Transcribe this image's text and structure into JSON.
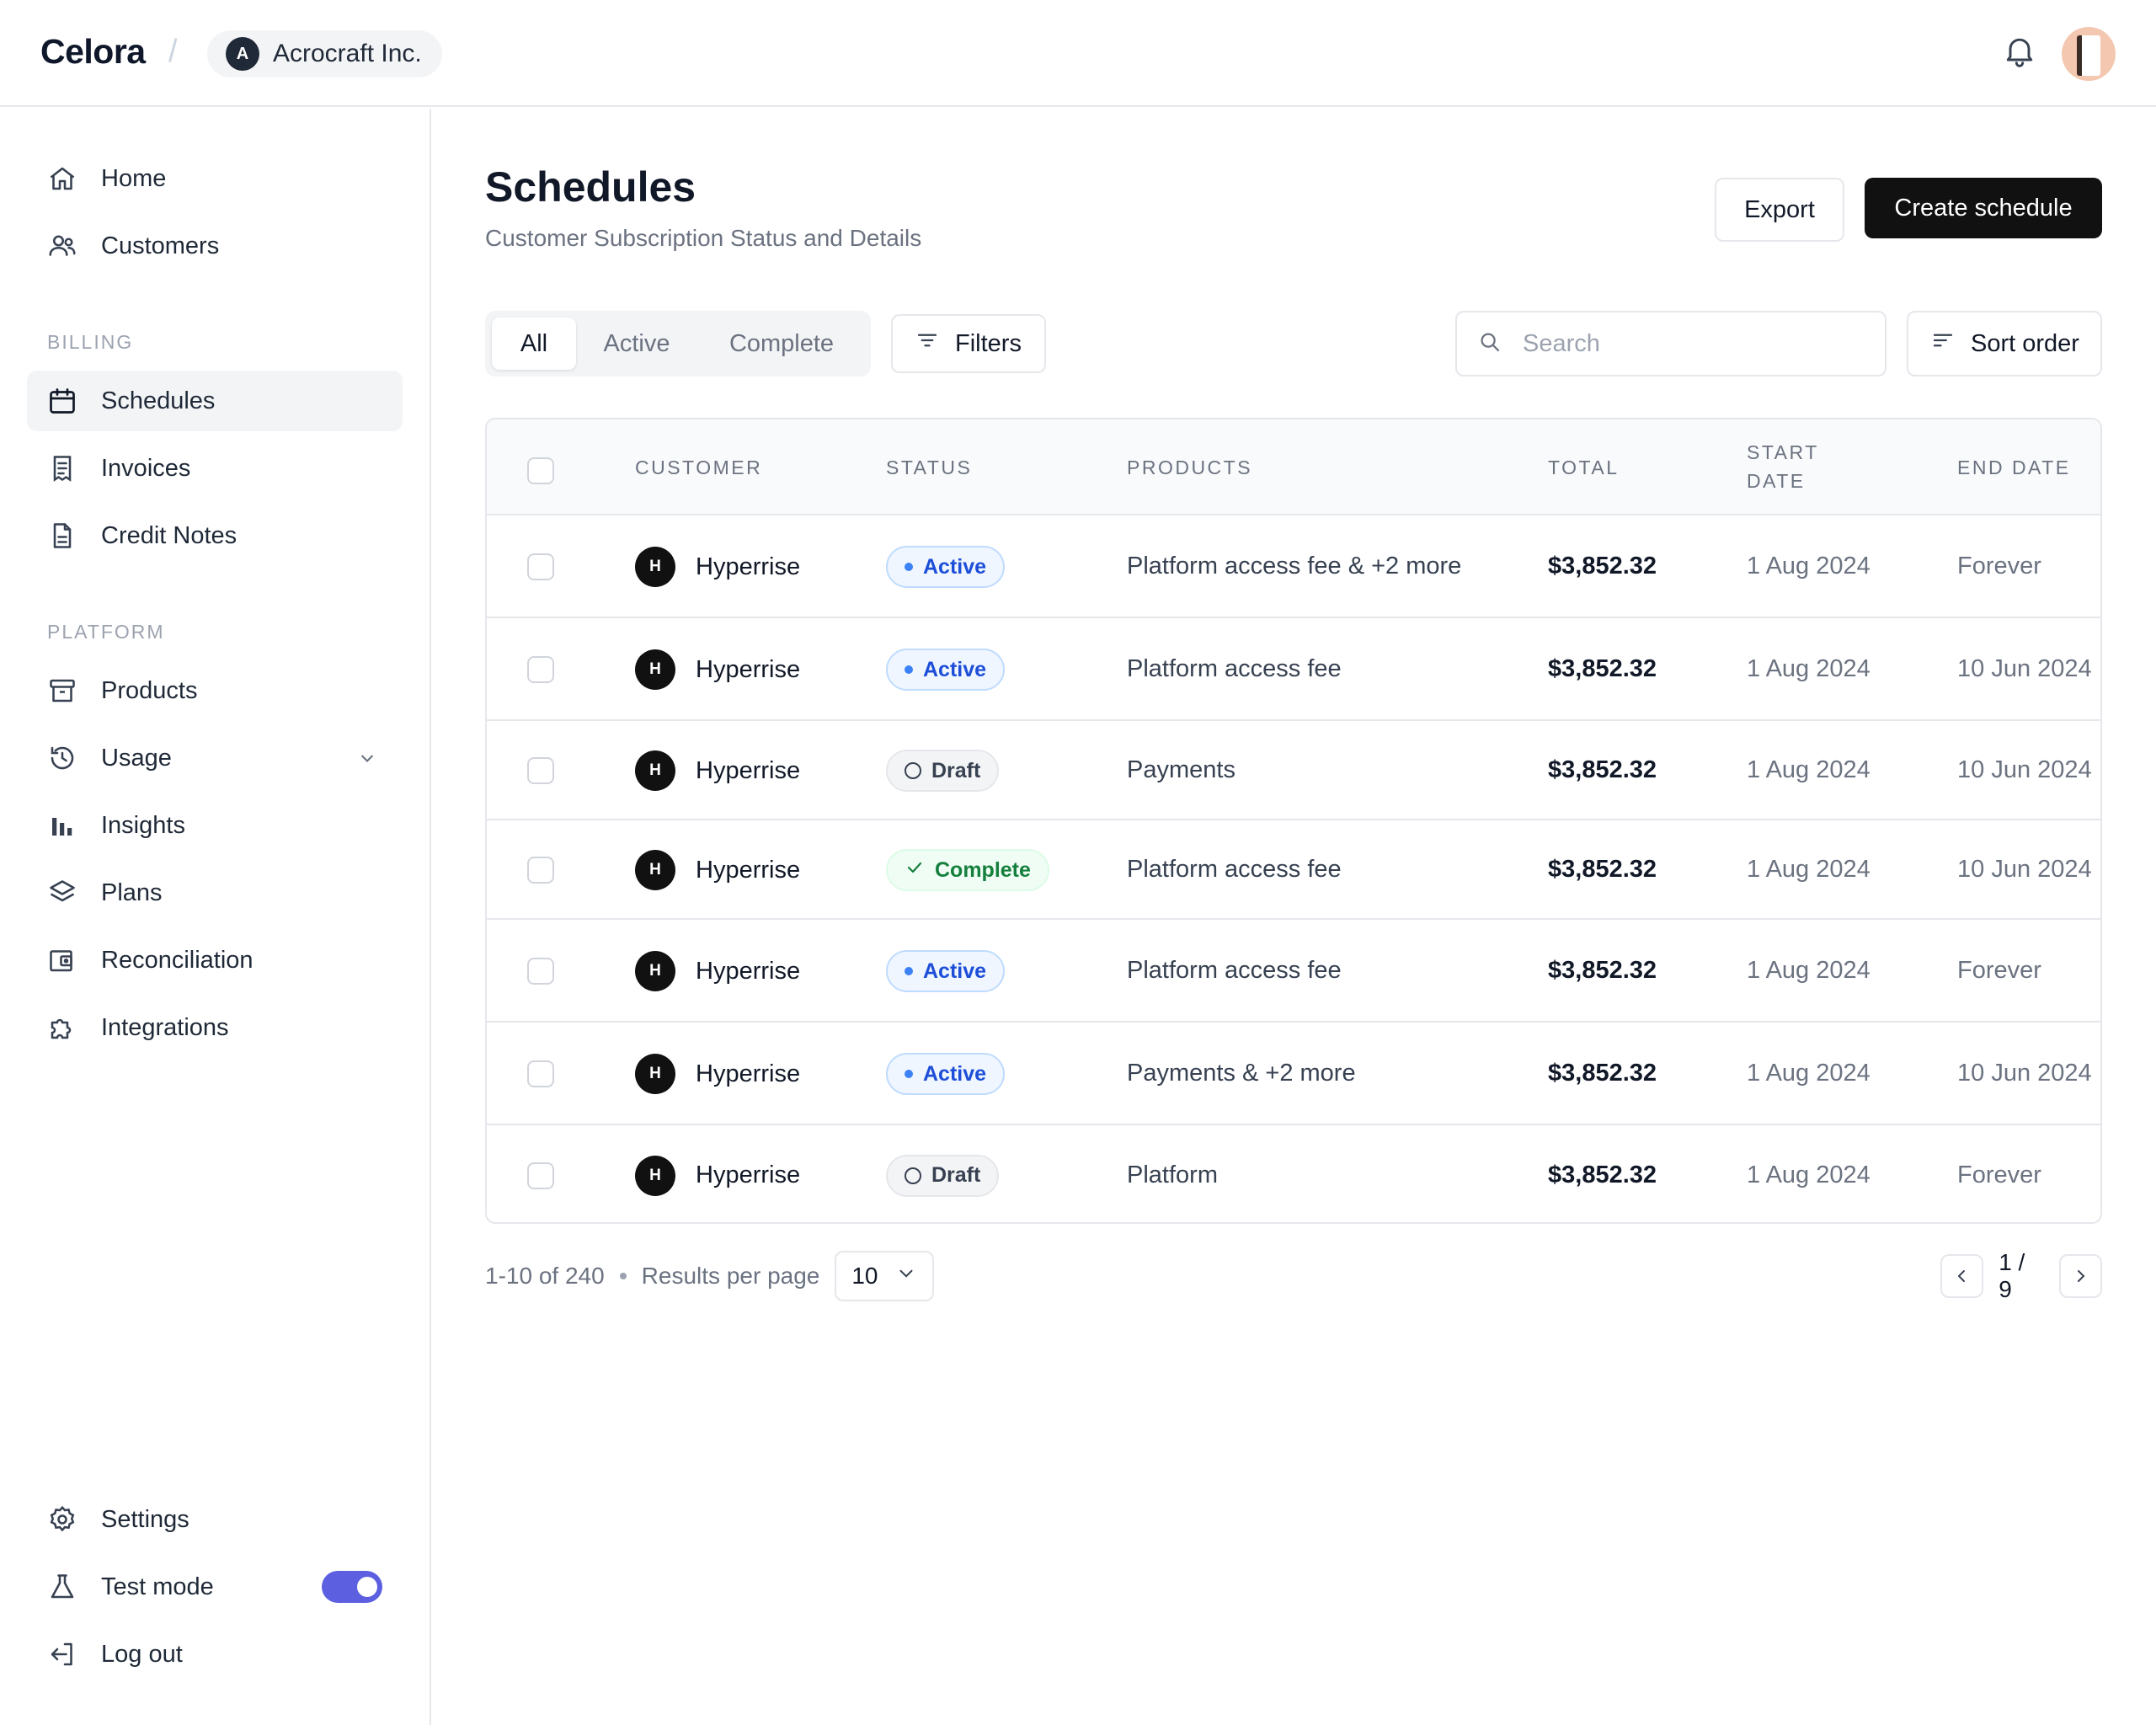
{
  "header": {
    "brand": "Celora",
    "separator": "/",
    "org": {
      "initial": "A",
      "name": "Acrocraft Inc."
    }
  },
  "sidebar": {
    "items_top": [
      {
        "label": "Home",
        "icon": "home-icon"
      },
      {
        "label": "Customers",
        "icon": "users-icon"
      }
    ],
    "section_billing": "BILLING",
    "items_billing": [
      {
        "label": "Schedules",
        "icon": "calendar-icon",
        "active": true
      },
      {
        "label": "Invoices",
        "icon": "receipt-icon"
      },
      {
        "label": "Credit Notes",
        "icon": "document-icon"
      }
    ],
    "section_platform": "PLATFORM",
    "items_platform": [
      {
        "label": "Products",
        "icon": "archive-box-icon"
      },
      {
        "label": "Usage",
        "icon": "history-icon",
        "expandable": true
      },
      {
        "label": "Insights",
        "icon": "bar-chart-icon"
      },
      {
        "label": "Plans",
        "icon": "layers-icon"
      },
      {
        "label": "Reconciliation",
        "icon": "wallet-icon"
      },
      {
        "label": "Integrations",
        "icon": "puzzle-icon"
      }
    ],
    "items_bottom": [
      {
        "label": "Settings",
        "icon": "gear-icon"
      },
      {
        "label": "Test mode",
        "icon": "flask-icon",
        "toggle_on": true
      },
      {
        "label": "Log out",
        "icon": "logout-icon"
      }
    ]
  },
  "main": {
    "title": "Schedules",
    "subtitle": "Customer Subscription Status and Details",
    "export_label": "Export",
    "create_label": "Create schedule",
    "tabs": [
      {
        "label": "All",
        "selected": true
      },
      {
        "label": "Active",
        "selected": false
      },
      {
        "label": "Complete",
        "selected": false
      }
    ],
    "filters_label": "Filters",
    "search_placeholder": "Search",
    "sort_label": "Sort order"
  },
  "table": {
    "columns": {
      "customer": "CUSTOMER",
      "status": "STATUS",
      "products": "PRODUCTS",
      "total": "TOTAL",
      "start_date_line1": "START",
      "start_date_line2": "DATE",
      "end_date": "END DATE"
    },
    "rows": [
      {
        "initial": "H",
        "customer": "Hyperrise",
        "status": "Active",
        "status_kind": "active",
        "products": "Platform access fee & +2 more",
        "total": "$3,852.32",
        "start": "1 Aug 2024",
        "end": "Forever"
      },
      {
        "initial": "H",
        "customer": "Hyperrise",
        "status": "Active",
        "status_kind": "active",
        "products": "Platform access fee",
        "total": "$3,852.32",
        "start": "1 Aug 2024",
        "end": "10 Jun 2024"
      },
      {
        "initial": "H",
        "customer": "Hyperrise",
        "status": "Draft",
        "status_kind": "draft",
        "products": "Payments",
        "total": "$3,852.32",
        "start": "1 Aug 2024",
        "end": "10 Jun 2024"
      },
      {
        "initial": "H",
        "customer": "Hyperrise",
        "status": "Complete",
        "status_kind": "complete",
        "products": "Platform access fee",
        "total": "$3,852.32",
        "start": "1 Aug 2024",
        "end": "10 Jun 2024"
      },
      {
        "initial": "H",
        "customer": "Hyperrise",
        "status": "Active",
        "status_kind": "active",
        "products": "Platform access fee",
        "total": "$3,852.32",
        "start": "1 Aug 2024",
        "end": "Forever"
      },
      {
        "initial": "H",
        "customer": "Hyperrise",
        "status": "Active",
        "status_kind": "active",
        "products": "Payments & +2 more",
        "total": "$3,852.32",
        "start": "1 Aug 2024",
        "end": "10 Jun 2024"
      },
      {
        "initial": "H",
        "customer": "Hyperrise",
        "status": "Draft",
        "status_kind": "draft",
        "products": "Platform",
        "total": "$3,852.32",
        "start": "1 Aug 2024",
        "end": "Forever"
      }
    ]
  },
  "footer": {
    "range": "1-10 of 240",
    "per_page_label": "Results per page",
    "per_page_value": "10",
    "page": "1 / 9"
  },
  "colors": {
    "accent_toggle": "#5b5fe0",
    "primary_button": "#111111",
    "active_badge": "#1d4ed8",
    "complete_badge": "#15803d"
  }
}
